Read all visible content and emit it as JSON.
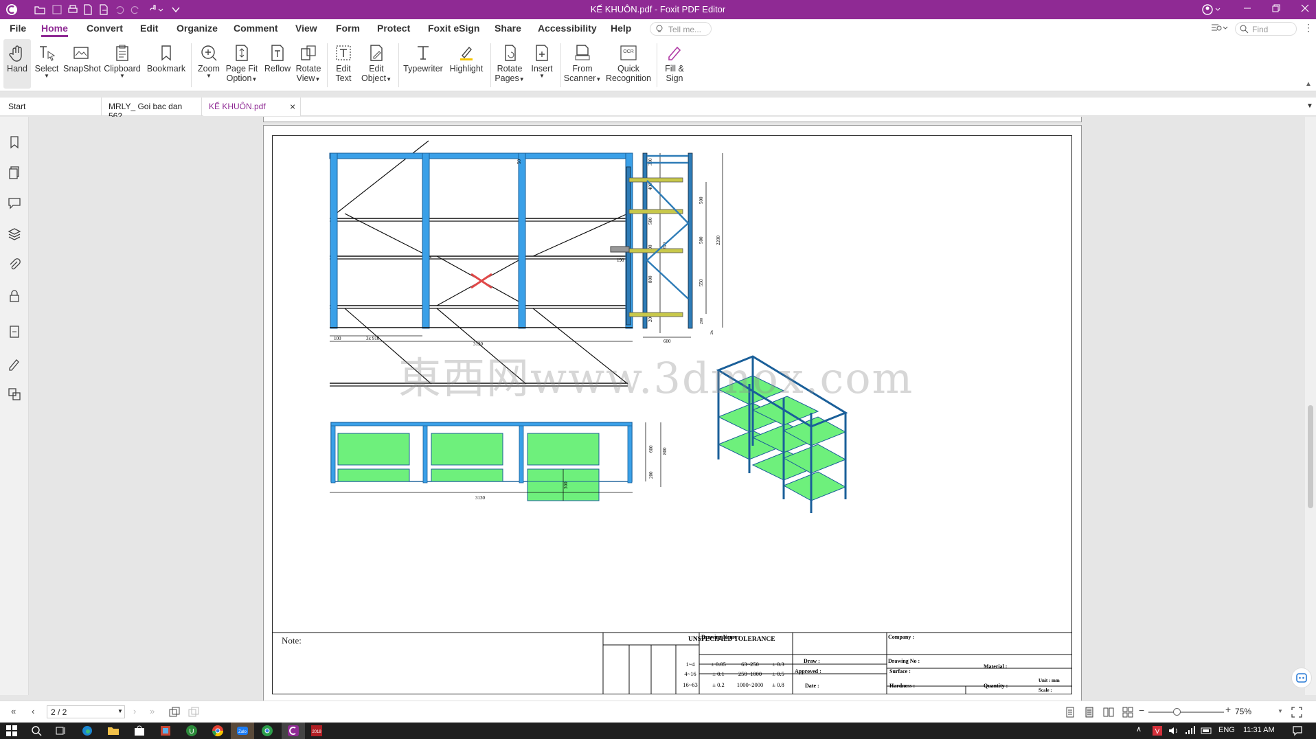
{
  "titlebar": {
    "title": "KẾ KHUÔN.pdf - Foxit PDF Editor",
    "min_icon": "minimize-icon",
    "restore_icon": "restore-icon",
    "close_icon": "close-icon"
  },
  "menu": {
    "items": [
      "File",
      "Home",
      "Convert",
      "Edit",
      "Organize",
      "Comment",
      "View",
      "Form",
      "Protect",
      "Foxit eSign",
      "Share",
      "Accessibility",
      "Help"
    ],
    "active": "Home",
    "tell_me_placeholder": "Tell me...",
    "find_placeholder": "Find"
  },
  "ribbon": {
    "hand": "Hand",
    "select": "Select",
    "snapshot": "SnapShot",
    "clipboard": "Clipboard",
    "bookmark": "Bookmark",
    "zoom": "Zoom",
    "page_fit_1": "Page Fit",
    "page_fit_2": "Option",
    "reflow": "Reflow",
    "rotate_view_1": "Rotate",
    "rotate_view_2": "View",
    "edit_text_1": "Edit",
    "edit_text_2": "Text",
    "edit_object_1": "Edit",
    "edit_object_2": "Object",
    "typewriter": "Typewriter",
    "highlight": "Highlight",
    "rotate_pages_1": "Rotate",
    "rotate_pages_2": "Pages",
    "insert": "Insert",
    "from_scanner_1": "From",
    "from_scanner_2": "Scanner",
    "quick_rec_1": "Quick",
    "quick_rec_2": "Recognition",
    "fill_sign_1": "Fill &",
    "fill_sign_2": "Sign"
  },
  "tabs": {
    "start": "Start",
    "tab1": "MRLY_ Goi bac dan 562...",
    "tab2": "KẾ KHUÔN.pdf"
  },
  "drawing": {
    "watermark": "東西网www.3dmox.com",
    "front": {
      "dims_right": [
        "300",
        "400",
        "500",
        "500",
        "800",
        "200"
      ],
      "total_height": "2200",
      "dim_50": "50",
      "dim_100": "100",
      "dim_3x910": "3x 910",
      "width": "3130"
    },
    "side": {
      "dims_right": [
        "500",
        "500",
        "550"
      ],
      "total_height": "2200",
      "dim_190": "190",
      "dim_600": "600",
      "dim_200": "200",
      "dim_2x": "2x"
    },
    "top": {
      "dim_600": "600",
      "dim_800": "800",
      "dim_200": "200",
      "dim_300": "300",
      "width": "3130"
    },
    "title_block": {
      "note": "Note:",
      "unspecified": "UNSPECIFIED TOLERANCE",
      "r1": "1~4",
      "r2": "4~16",
      "r3": "16~63",
      "t1": "± 0.05",
      "t2": "± 0.1",
      "t3": "± 0.2",
      "r4": "63~250",
      "r5": "250~1000",
      "r6": "1000~2000",
      "t4": "± 0.3",
      "t5": "± 0.5",
      "t6": "± 0.8",
      "drawing_name": "Drawing Name :",
      "company": "Company :",
      "draw": "Draw :",
      "drawing_no": "Drawing No :",
      "material": "Material :",
      "approved": "Approved :",
      "surface": "Surface :",
      "date": "Date :",
      "hardness": "Hardness :",
      "quantity": "Quantity :",
      "unit": "Unit : mm",
      "scale": "Scale :"
    }
  },
  "status": {
    "page": "2 / 2",
    "zoom": "75%"
  },
  "taskbar": {
    "lang": "ENG",
    "time": "11:31 AM"
  },
  "colors": {
    "brand": "#8f2a94",
    "frame_blue": "#3aa0e8",
    "shelf_yellow": "#c8c84a",
    "panel_green": "#6ef07c"
  }
}
